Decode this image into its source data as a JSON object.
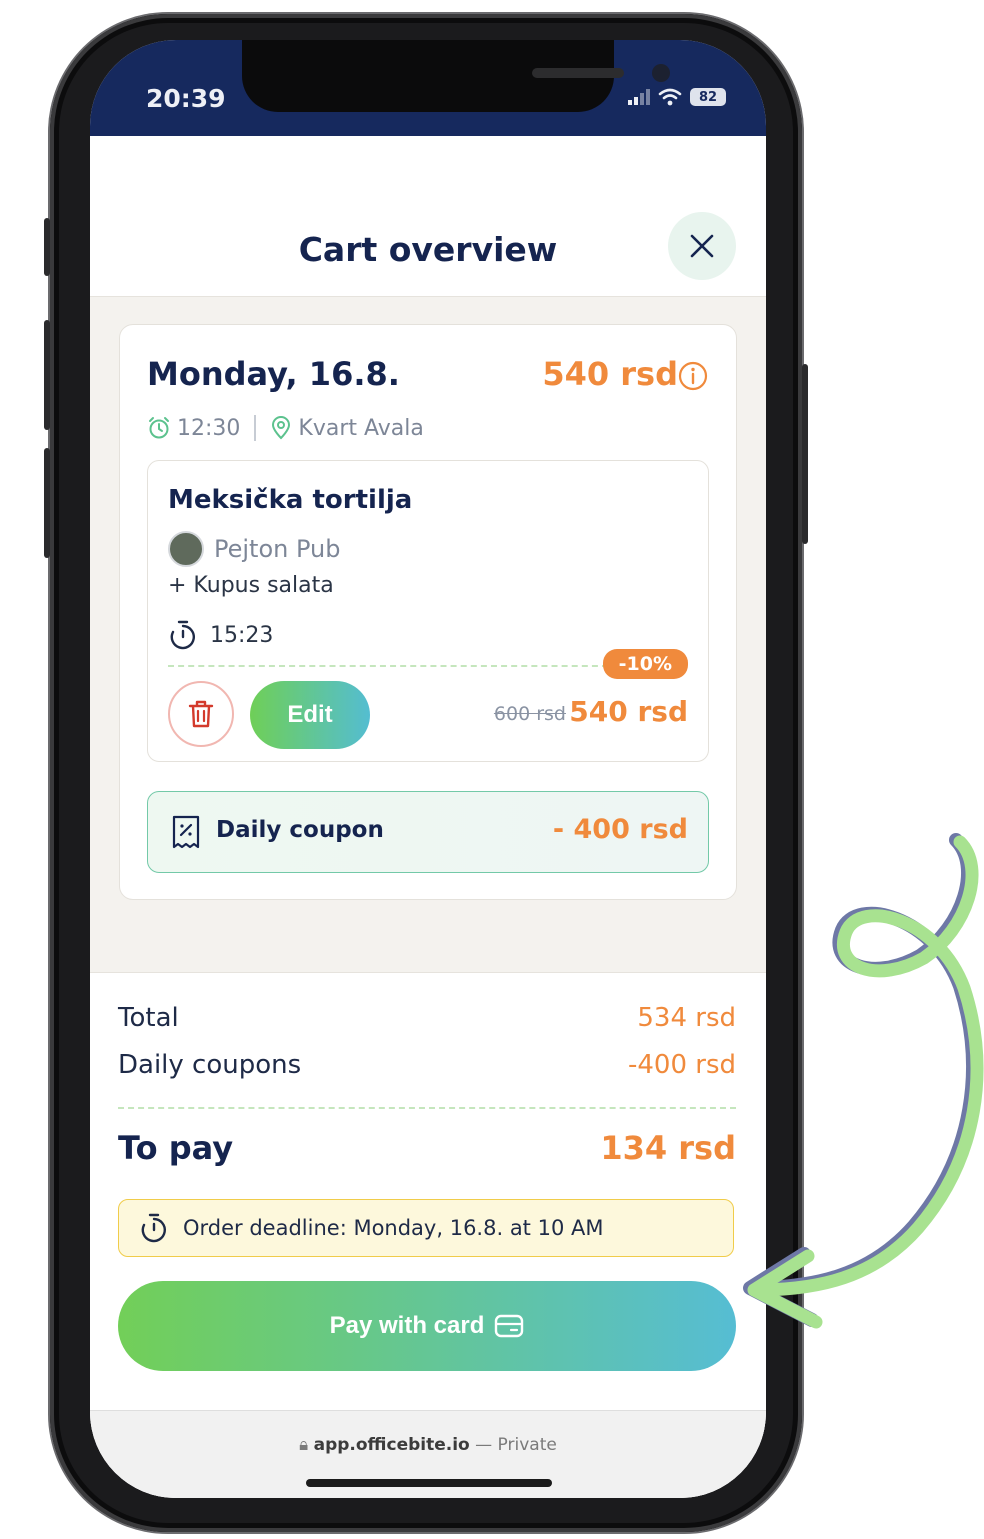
{
  "status_bar": {
    "time": "20:39",
    "battery": "82"
  },
  "header": {
    "title": "Cart overview"
  },
  "order": {
    "day": "Monday, 16.8.",
    "day_price": "540 rsd",
    "pickup_time": "12:30",
    "location": "Kvart Avala",
    "item": {
      "name": "Meksička tortilja",
      "vendor": "Pejton Pub",
      "extra": "+ Kupus salata",
      "timer": "15:23",
      "discount_badge": "-10%",
      "edit_label": "Edit",
      "old_price": "600 rsd",
      "new_price": "540 rsd"
    },
    "coupon": {
      "label": "Daily coupon",
      "value": "- 400 rsd"
    }
  },
  "summary": {
    "total_label": "Total",
    "total_value": "534 rsd",
    "coupons_label": "Daily coupons",
    "coupons_value": "-400 rsd",
    "to_pay_label": "To pay",
    "to_pay_value": "134 rsd",
    "deadline": "Order deadline: Monday,  16.8. at 10 AM",
    "pay_label": "Pay with card"
  },
  "browser": {
    "domain": "app.officebite.io",
    "suffix": "— Private"
  },
  "colors": {
    "navy": "#15244f",
    "accent_orange": "#f08a3c",
    "gradient_green": "#72cf58",
    "gradient_blue": "#56bdd3",
    "status_bar": "#16295e"
  }
}
